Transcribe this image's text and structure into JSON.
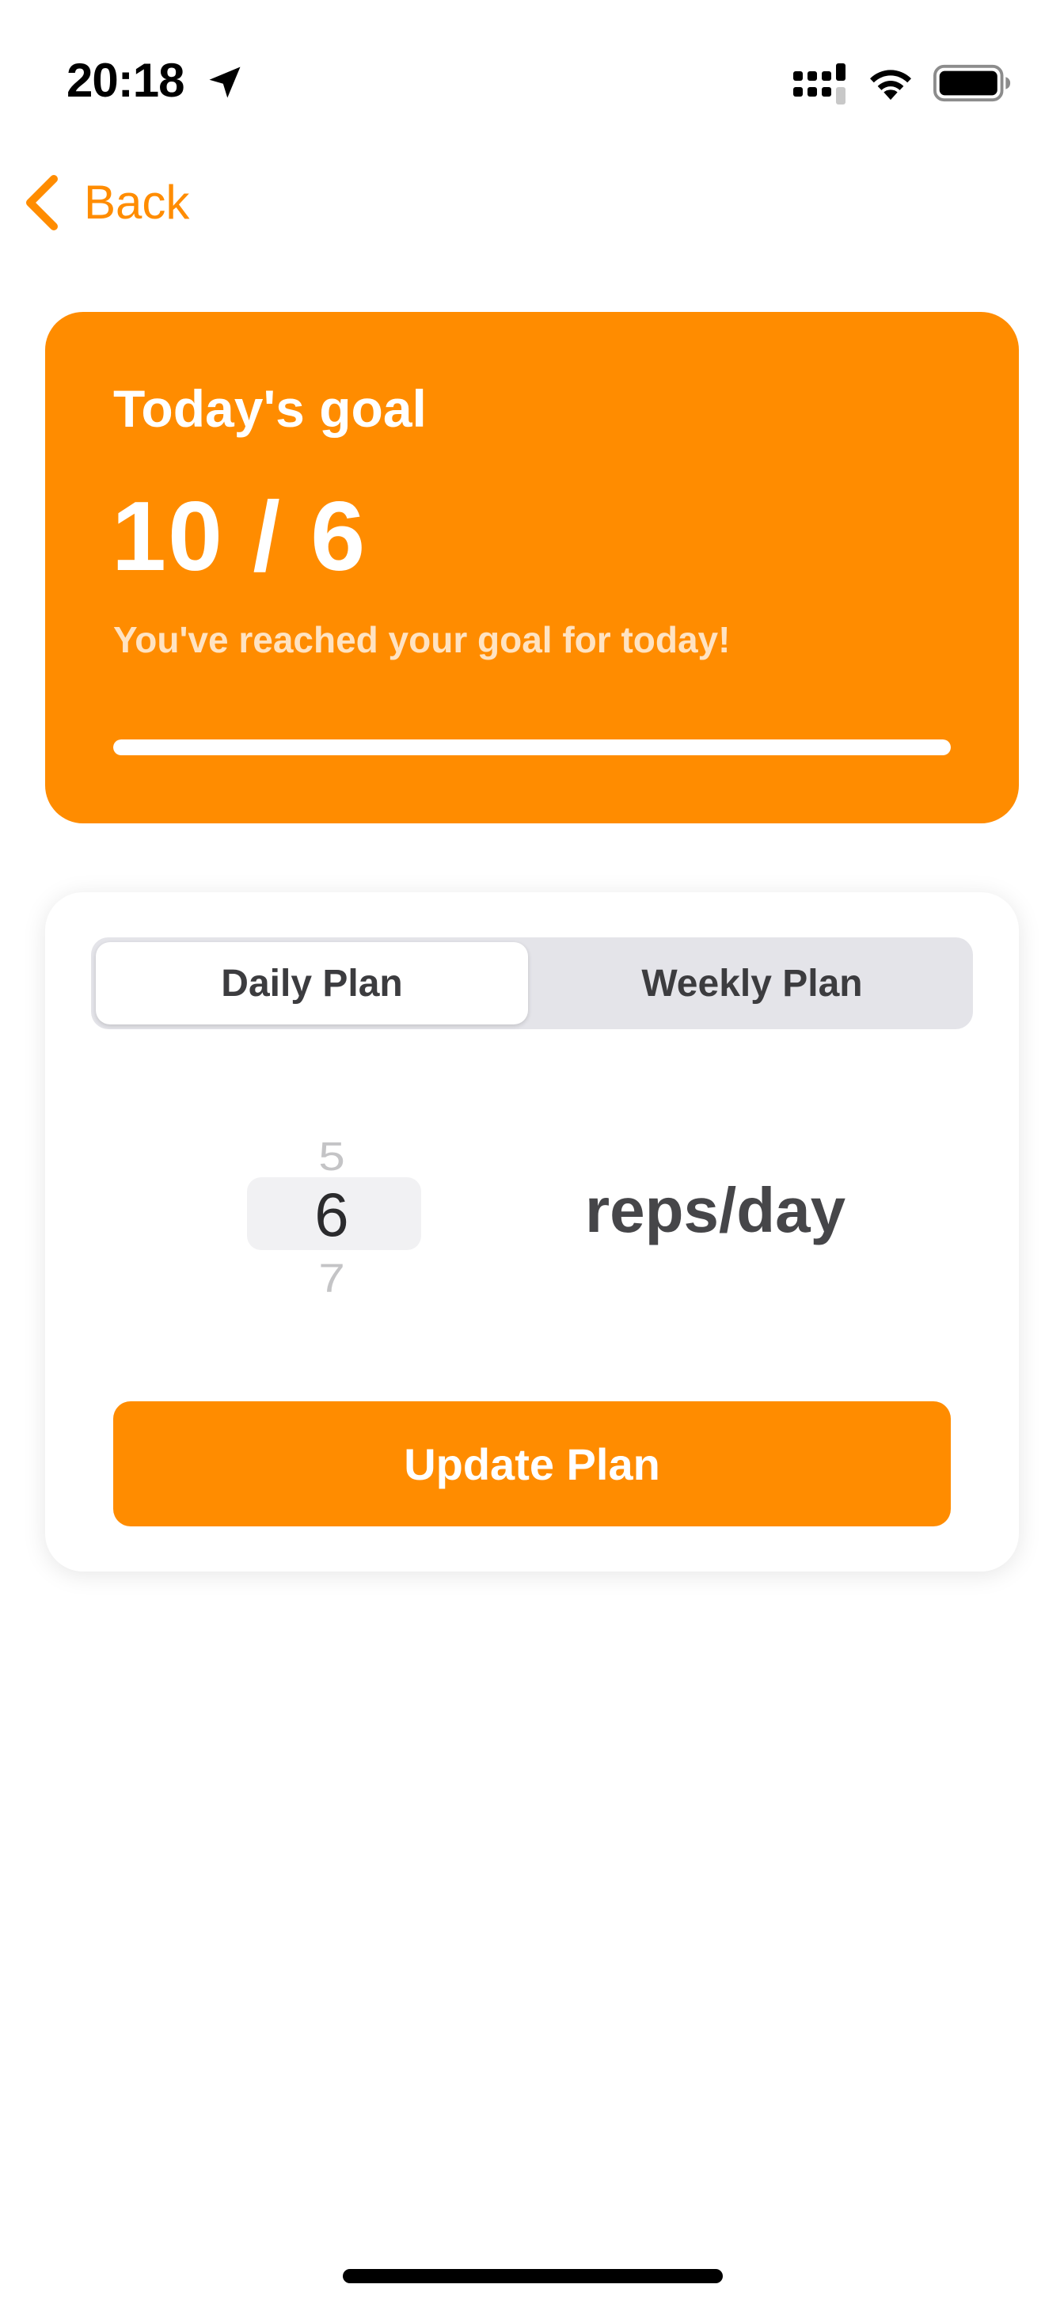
{
  "status_bar": {
    "time": "20:18",
    "icons": [
      "location-arrow-icon",
      "cellular-signal-icon",
      "wifi-icon",
      "battery-icon"
    ]
  },
  "nav": {
    "back_label": "Back",
    "back_icon": "chevron-left-icon"
  },
  "goal_card": {
    "title": "Today's goal",
    "progress_text": "10 / 6",
    "message": "You've reached your goal for today!",
    "progress_fraction": 1.0
  },
  "plan_card": {
    "tabs": [
      {
        "label": "Daily Plan",
        "selected": true
      },
      {
        "label": "Weekly Plan",
        "selected": false
      }
    ],
    "picker": {
      "prev": "5",
      "current": "6",
      "next": "7"
    },
    "unit": "reps/day",
    "update_label": "Update Plan"
  },
  "colors": {
    "accent": "#ff8c00",
    "card_text": "#ffffff",
    "message_text": "#ffe3c2",
    "segment_bg": "#e4e4e9"
  }
}
